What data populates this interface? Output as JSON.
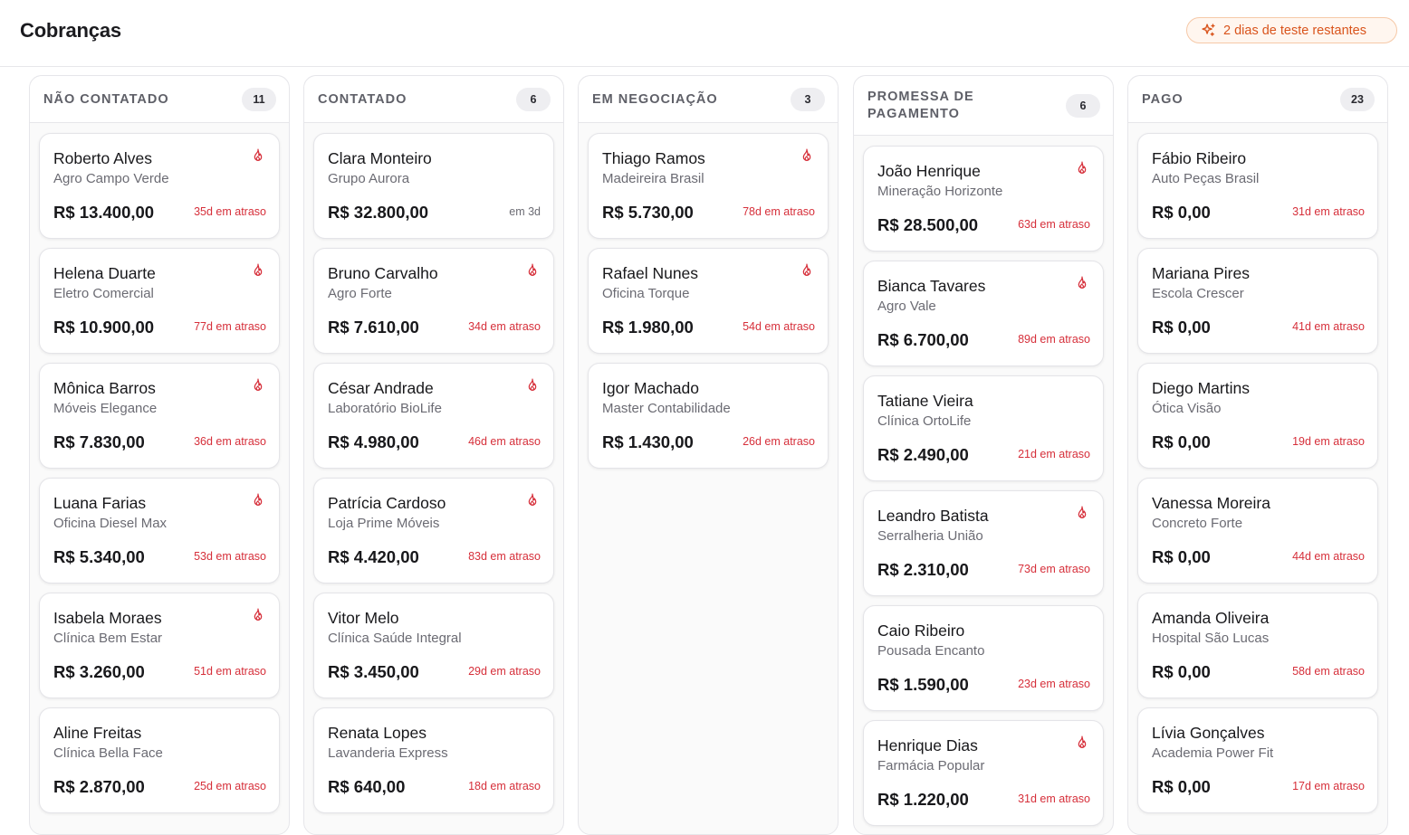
{
  "header": {
    "title": "Cobranças",
    "trial_badge": "2 dias de teste restantes"
  },
  "columns": [
    {
      "title": "NÃO CONTATADO",
      "count": "11",
      "cards": [
        {
          "name": "Roberto Alves",
          "company": "Agro Campo Verde",
          "amount": "R$ 13.400,00",
          "due": "35d em atraso",
          "hot": true
        },
        {
          "name": "Helena Duarte",
          "company": "Eletro Comercial",
          "amount": "R$ 10.900,00",
          "due": "77d em atraso",
          "hot": true
        },
        {
          "name": "Mônica Barros",
          "company": "Móveis Elegance",
          "amount": "R$ 7.830,00",
          "due": "36d em atraso",
          "hot": true
        },
        {
          "name": "Luana Farias",
          "company": "Oficina Diesel Max",
          "amount": "R$ 5.340,00",
          "due": "53d em atraso",
          "hot": true
        },
        {
          "name": "Isabela Moraes",
          "company": "Clínica Bem Estar",
          "amount": "R$ 3.260,00",
          "due": "51d em atraso",
          "hot": true
        },
        {
          "name": "Aline Freitas",
          "company": "Clínica Bella Face",
          "amount": "R$ 2.870,00",
          "due": "25d em atraso",
          "hot": false
        }
      ]
    },
    {
      "title": "CONTATADO",
      "count": "6",
      "cards": [
        {
          "name": "Clara Monteiro",
          "company": "Grupo Aurora",
          "amount": "R$ 32.800,00",
          "due": "em 3d",
          "hot": false
        },
        {
          "name": "Bruno Carvalho",
          "company": "Agro Forte",
          "amount": "R$ 7.610,00",
          "due": "34d em atraso",
          "hot": true
        },
        {
          "name": "César Andrade",
          "company": "Laboratório BioLife",
          "amount": "R$ 4.980,00",
          "due": "46d em atraso",
          "hot": true
        },
        {
          "name": "Patrícia Cardoso",
          "company": "Loja Prime Móveis",
          "amount": "R$ 4.420,00",
          "due": "83d em atraso",
          "hot": true
        },
        {
          "name": "Vitor Melo",
          "company": "Clínica Saúde Integral",
          "amount": "R$ 3.450,00",
          "due": "29d em atraso",
          "hot": false
        },
        {
          "name": "Renata Lopes",
          "company": "Lavanderia Express",
          "amount": "R$ 640,00",
          "due": "18d em atraso",
          "hot": false
        }
      ]
    },
    {
      "title": "EM NEGOCIAÇÃO",
      "count": "3",
      "cards": [
        {
          "name": "Thiago Ramos",
          "company": "Madeireira Brasil",
          "amount": "R$ 5.730,00",
          "due": "78d em atraso",
          "hot": true
        },
        {
          "name": "Rafael Nunes",
          "company": "Oficina Torque",
          "amount": "R$ 1.980,00",
          "due": "54d em atraso",
          "hot": true
        },
        {
          "name": "Igor Machado",
          "company": "Master Contabilidade",
          "amount": "R$ 1.430,00",
          "due": "26d em atraso",
          "hot": false
        }
      ]
    },
    {
      "title": "PROMESSA DE PAGAMENTO",
      "count": "6",
      "cards": [
        {
          "name": "João Henrique",
          "company": "Mineração Horizonte",
          "amount": "R$ 28.500,00",
          "due": "63d em atraso",
          "hot": true
        },
        {
          "name": "Bianca Tavares",
          "company": "Agro Vale",
          "amount": "R$ 6.700,00",
          "due": "89d em atraso",
          "hot": true
        },
        {
          "name": "Tatiane Vieira",
          "company": "Clínica OrtoLife",
          "amount": "R$ 2.490,00",
          "due": "21d em atraso",
          "hot": false
        },
        {
          "name": "Leandro Batista",
          "company": "Serralheria União",
          "amount": "R$ 2.310,00",
          "due": "73d em atraso",
          "hot": true
        },
        {
          "name": "Caio Ribeiro",
          "company": "Pousada Encanto",
          "amount": "R$ 1.590,00",
          "due": "23d em atraso",
          "hot": false
        },
        {
          "name": "Henrique Dias",
          "company": "Farmácia Popular",
          "amount": "R$ 1.220,00",
          "due": "31d em atraso",
          "hot": true
        }
      ]
    },
    {
      "title": "PAGO",
      "count": "23",
      "cards": [
        {
          "name": "Fábio Ribeiro",
          "company": "Auto Peças Brasil",
          "amount": "R$ 0,00",
          "due": "31d em atraso",
          "hot": false
        },
        {
          "name": "Mariana Pires",
          "company": "Escola Crescer",
          "amount": "R$ 0,00",
          "due": "41d em atraso",
          "hot": false
        },
        {
          "name": "Diego Martins",
          "company": "Ótica Visão",
          "amount": "R$ 0,00",
          "due": "19d em atraso",
          "hot": false
        },
        {
          "name": "Vanessa Moreira",
          "company": "Concreto Forte",
          "amount": "R$ 0,00",
          "due": "44d em atraso",
          "hot": false
        },
        {
          "name": "Amanda Oliveira",
          "company": "Hospital São Lucas",
          "amount": "R$ 0,00",
          "due": "58d em atraso",
          "hot": false
        },
        {
          "name": "Lívia Gonçalves",
          "company": "Academia Power Fit",
          "amount": "R$ 0,00",
          "due": "17d em atraso",
          "hot": false
        }
      ]
    }
  ]
}
